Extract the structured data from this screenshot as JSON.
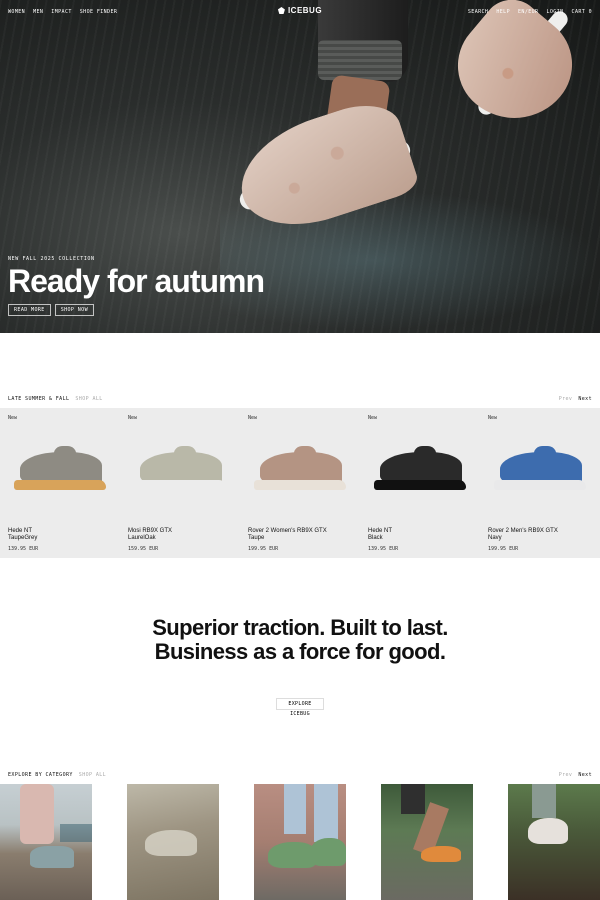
{
  "nav": {
    "left": [
      "WOMEN",
      "MEN",
      "IMPACT",
      "SHOE FINDER"
    ],
    "brand": "ICEBUG",
    "right": [
      "SEARCH",
      "HELP",
      "EN/EUR",
      "LOGIN",
      "CART 0"
    ]
  },
  "hero": {
    "eyebrow": "NEW FALL 2025 COLLECTION",
    "title": "Ready for autumn",
    "buttons": [
      "READ MORE",
      "SHOP NOW"
    ]
  },
  "products_section": {
    "title": "LATE SUMMER & FALL",
    "shop_all": "SHOP ALL",
    "prev": "Prev",
    "next": "Next",
    "items": [
      {
        "badge": "New",
        "name_line1": "Hede NT",
        "name_line2": "TaupeGrey",
        "price": "139.95 EUR",
        "upper_color": "#8e8b83",
        "sole_color": "#d8a35a"
      },
      {
        "badge": "New",
        "name_line1": "Mosi RB9X GTX",
        "name_line2": "LaurelOak",
        "price": "159.95 EUR",
        "upper_color": "#b9b8a8",
        "sole_color": "#ececec"
      },
      {
        "badge": "New",
        "name_line1": "Rover 2 Women's RB9X GTX",
        "name_line2": "Taupe",
        "price": "199.95 EUR",
        "upper_color": "#b49483",
        "sole_color": "#e8e1d8"
      },
      {
        "badge": "New",
        "name_line1": "Hede NT",
        "name_line2": "Black",
        "price": "139.95 EUR",
        "upper_color": "#2a2a2a",
        "sole_color": "#111111"
      },
      {
        "badge": "New",
        "name_line1": "Rover 2 Men's RB9X GTX",
        "name_line2": "Navy",
        "price": "199.95 EUR",
        "upper_color": "#3d6cae",
        "sole_color": "#e9e9ea"
      }
    ]
  },
  "tagline": {
    "text": "Superior traction. Built to last. Business as a force for good.",
    "button": "EXPLORE ICEBUG"
  },
  "categories_section": {
    "title": "EXPLORE BY CATEGORY",
    "shop_all": "SHOP ALL",
    "prev": "Prev",
    "next": "Next"
  }
}
